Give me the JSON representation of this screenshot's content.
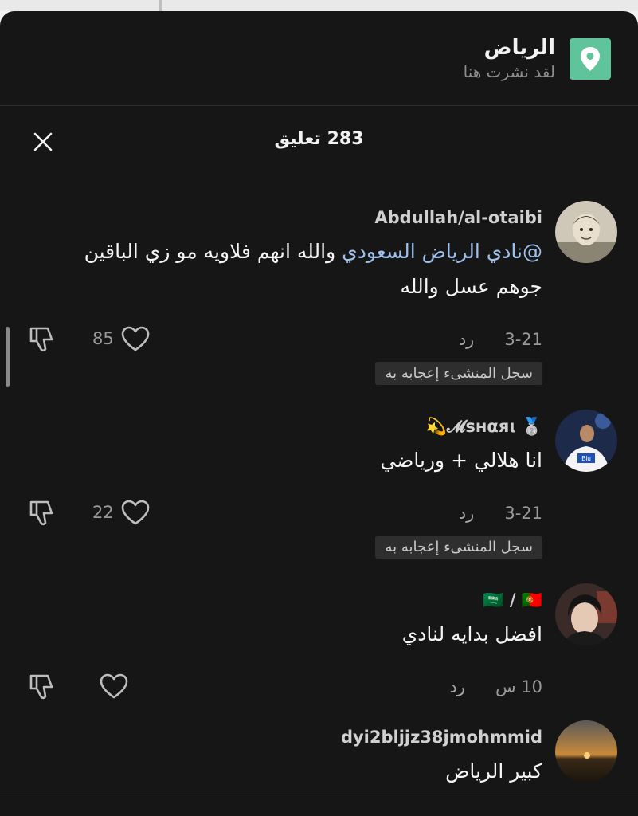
{
  "location": {
    "title": "الرياض",
    "subtitle": "لقد نشرت هنا",
    "icon": "location-pin-icon",
    "accent": "#5fc49a"
  },
  "comments_panel": {
    "count_label": "283 تعليق",
    "close_icon": "close-icon"
  },
  "comments": [
    {
      "username": "Abdullah/al-otaibi",
      "mention": "@نادي الرياض السعودي",
      "text": " والله انهم فلاويه مو زي الباقين جوهم عسل والله",
      "date": "3-21",
      "reply_label": "رد",
      "likes": "85",
      "creator_badge": "سجل المنشىء إعجابه به"
    },
    {
      "username": "𝓜ѕнαяι💫",
      "username_prefix": "🥈",
      "text": "انا هلالي + ورياضي",
      "date": "3-21",
      "reply_label": "رد",
      "likes": "22",
      "creator_badge": "سجل المنشىء إعجابه به"
    },
    {
      "username": "🇸🇦 / 🇵🇹",
      "text": "افضل بدايه لنادي",
      "date": "10 س",
      "reply_label": "رد",
      "likes": ""
    },
    {
      "username": "dyi2bljjz38jmohmmid",
      "text": "كبير الرياض"
    }
  ]
}
